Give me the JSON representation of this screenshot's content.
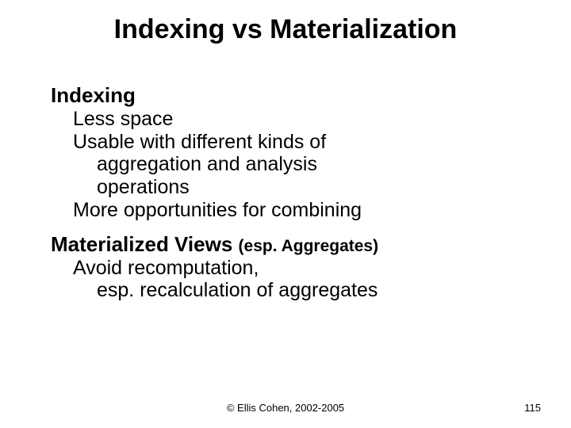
{
  "title": "Indexing vs Materialization",
  "section1": {
    "heading": "Indexing",
    "b1": "Less space",
    "b2a": "Usable with different kinds of",
    "b2b": "aggregation and analysis",
    "b2c": "operations",
    "b3": "More opportunities for combining"
  },
  "section2": {
    "heading": "Materialized Views ",
    "qualifier": "(esp. Aggregates)",
    "b1a": "Avoid recomputation,",
    "b1b": "esp. recalculation of aggregates"
  },
  "footer": {
    "copyright": "© Ellis Cohen, 2002-2005",
    "page": "115"
  }
}
